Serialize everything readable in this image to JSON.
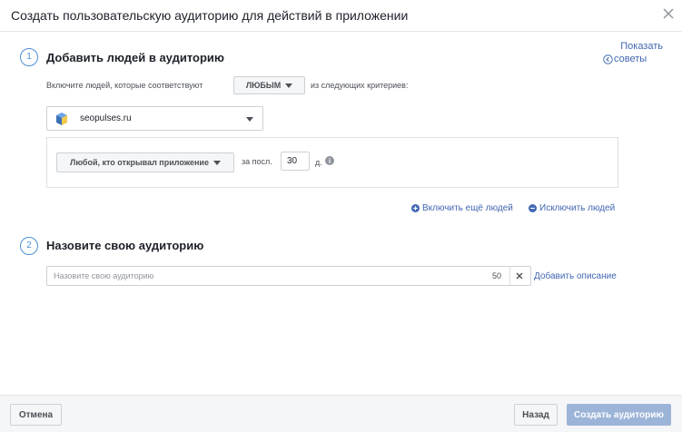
{
  "dialog": {
    "title": "Создать пользовательскую аудиторию для действий в приложении",
    "tips": {
      "line1": "Показать",
      "line2": "советы"
    }
  },
  "step1": {
    "number": "1",
    "title": "Добавить людей в аудиторию",
    "include_prefix": "Включите людей, которые соответствуют",
    "match_mode": "ЛЮБЫМ",
    "include_suffix": "из следующих критериев:",
    "app": {
      "name": "seopulses.ru",
      "icon": "app-cube-icon"
    },
    "rule": {
      "event_label": "Любой, кто открывал приложение",
      "period_prefix": "за посл.",
      "days": "30",
      "days_suffix": "д."
    },
    "include_more": "Включить ещё людей",
    "exclude": "Исключить людей"
  },
  "step2": {
    "number": "2",
    "title": "Назовите свою аудиторию",
    "name_placeholder": "Назовите свою аудиторию",
    "name_value": "",
    "char_limit": "50",
    "add_description": "Добавить описание"
  },
  "footer": {
    "cancel": "Отмена",
    "back": "Назад",
    "create": "Создать аудиторию"
  },
  "colors": {
    "link": "#4267b2",
    "step_accent": "#4b8fd6",
    "primary_disabled": "#9cb4d8"
  }
}
